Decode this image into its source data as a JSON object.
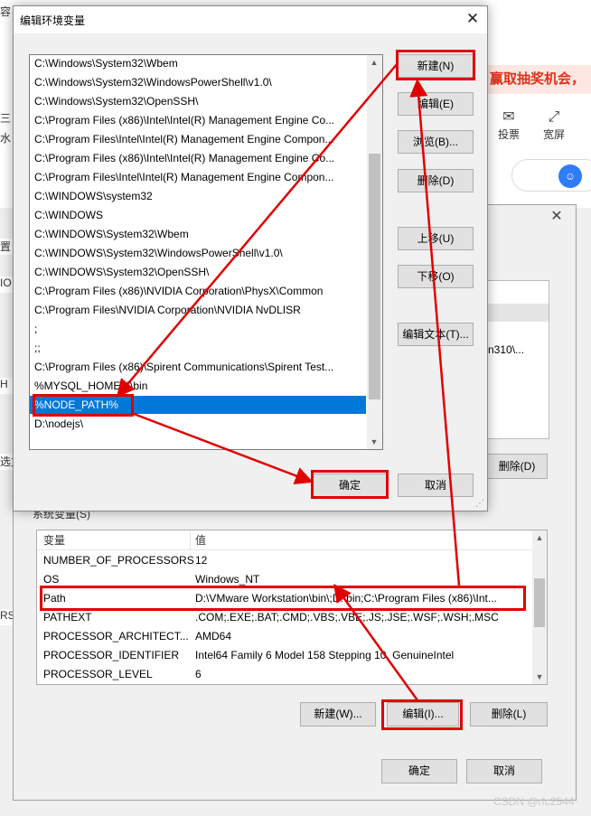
{
  "background": {
    "browser": {
      "promo_text": "赢取抽奖机会，",
      "tools": [
        {
          "icon": "vote-icon",
          "glyph": "✉",
          "label": "投票"
        },
        {
          "icon": "fullscreen-icon",
          "glyph": "⤢",
          "label": "宽屏"
        }
      ],
      "search_badge": "☺",
      "left_fragments": [
        "容",
        "三",
        "水",
        "置",
        "IO",
        "H",
        "选文",
        "RS"
      ]
    },
    "env_dialog": {
      "close_glyph": "✕",
      "user_var_fragment": "n310\\...",
      "user_delete_label": "删除(D)",
      "system_vars_title": "系统变量(S)",
      "table": {
        "headers": [
          "变量",
          "值"
        ],
        "rows": [
          {
            "name": "NUMBER_OF_PROCESSORS",
            "value": "12"
          },
          {
            "name": "OS",
            "value": "Windows_NT"
          },
          {
            "name": "Path",
            "value": "D:\\VMware Workstation\\bin\\;D:\\bin;C:\\Program Files (x86)\\Int..."
          },
          {
            "name": "PATHEXT",
            "value": ".COM;.EXE;.BAT;.CMD;.VBS;.VBE;.JS;.JSE;.WSF;.WSH;.MSC"
          },
          {
            "name": "PROCESSOR_ARCHITECT...",
            "value": "AMD64"
          },
          {
            "name": "PROCESSOR_IDENTIFIER",
            "value": "Intel64 Family 6 Model 158 Stepping 10, GenuineIntel"
          },
          {
            "name": "PROCESSOR_LEVEL",
            "value": "6"
          }
        ]
      },
      "buttons": {
        "new": "新建(W)...",
        "edit": "编辑(I)...",
        "delete": "删除(L)"
      },
      "ok": "确定",
      "cancel": "取消"
    }
  },
  "edit_dialog": {
    "title": "编辑环境变量",
    "close_glyph": "✕",
    "paths": [
      "C:\\Windows\\System32\\Wbem",
      "C:\\Windows\\System32\\WindowsPowerShell\\v1.0\\",
      "C:\\Windows\\System32\\OpenSSH\\",
      "C:\\Program Files (x86)\\Intel\\Intel(R) Management Engine Co...",
      "C:\\Program Files\\Intel\\Intel(R) Management Engine Compon...",
      "C:\\Program Files (x86)\\Intel\\Intel(R) Management Engine Co...",
      "C:\\Program Files\\Intel\\Intel(R) Management Engine Compon...",
      "C:\\WINDOWS\\system32",
      "C:\\WINDOWS",
      "C:\\WINDOWS\\System32\\Wbem",
      "C:\\WINDOWS\\System32\\WindowsPowerShell\\v1.0\\",
      "C:\\WINDOWS\\System32\\OpenSSH\\",
      "C:\\Program Files (x86)\\NVIDIA Corporation\\PhysX\\Common",
      "C:\\Program Files\\NVIDIA Corporation\\NVIDIA NvDLISR",
      ";",
      ";;",
      "C:\\Program Files (x86)\\Spirent Communications\\Spirent Test...",
      "%MYSQL_HOME%\\bin",
      "%NODE_PATH%",
      "D:\\nodejs\\"
    ],
    "selected_index": 18,
    "buttons": {
      "new": "新建(N)",
      "edit": "编辑(E)",
      "browse": "浏览(B)...",
      "delete": "删除(D)",
      "move_up": "上移(U)",
      "move_down": "下移(O)",
      "edit_text": "编辑文本(T)..."
    },
    "ok": "确定",
    "cancel": "取消"
  },
  "watermark": "CSDN @rfc2544",
  "colors": {
    "annotation_red": "#e10000",
    "selection_blue": "#0078d7"
  }
}
